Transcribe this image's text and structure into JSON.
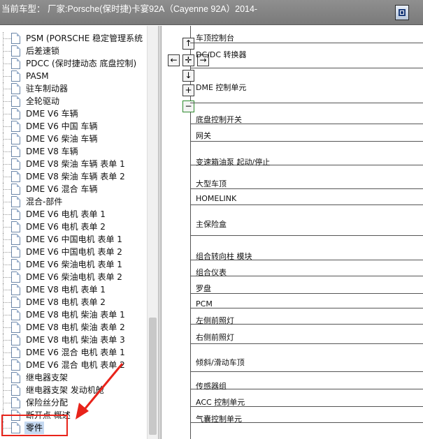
{
  "window": {
    "title": "当前车型： 厂家:Porsche(保时捷)卡宴92A（Cayenne 92A）2014-"
  },
  "tree": {
    "items": [
      {
        "label": "PSM (PORSCHE 稳定管理系统"
      },
      {
        "label": "后差速锁"
      },
      {
        "label": "PDCC (保时捷动态 底盘控制)"
      },
      {
        "label": "PASM"
      },
      {
        "label": "驻车制动器"
      },
      {
        "label": "全轮驱动"
      },
      {
        "label": "DME V6 车辆"
      },
      {
        "label": "DME V6 中国 车辆"
      },
      {
        "label": "DME V6 柴油 车辆"
      },
      {
        "label": "DME V8 车辆"
      },
      {
        "label": "DME V8 柴油 车辆 表单 1"
      },
      {
        "label": "DME V8 柴油 车辆 表单 2"
      },
      {
        "label": "DME V6 混合 车辆"
      },
      {
        "label": "混合-部件"
      },
      {
        "label": "DME V6 电机 表单 1"
      },
      {
        "label": "DME V6 电机 表单 2"
      },
      {
        "label": "DME V6 中国电机 表单 1"
      },
      {
        "label": "DME V6 中国电机 表单 2"
      },
      {
        "label": "DME V6 柴油电机 表单 1"
      },
      {
        "label": "DME V6 柴油电机 表单 2"
      },
      {
        "label": "DME V8 电机 表单 1"
      },
      {
        "label": "DME V8 电机 表单 2"
      },
      {
        "label": "DME V8 电机 柴油 表单 1"
      },
      {
        "label": "DME V8 电机 柴油 表单 2"
      },
      {
        "label": "DME V8 电机 柴油 表单 3"
      },
      {
        "label": "DME V6 混合 电机 表单 1"
      },
      {
        "label": "DME V6 混合 电机 表单 2"
      },
      {
        "label": "继电器支架"
      },
      {
        "label": "继电器支架 发动机舱"
      },
      {
        "label": "保险丝分配"
      },
      {
        "label": "断开点 概述"
      },
      {
        "label": "零件",
        "selected": true
      }
    ]
  },
  "diagram": {
    "nav": {
      "up": "↑",
      "left": "←",
      "center": "✛",
      "right": "→",
      "down": "↓",
      "zoom_in": "+",
      "zoom_out": "−"
    },
    "rows": [
      {
        "label": "车顶控制台"
      },
      {
        "label": "DC/DC 转换器"
      },
      {
        "label": "DME 控制单元"
      },
      {
        "label": "底盘控制开关"
      },
      {
        "label": "网关"
      },
      {
        "label": "变速箱油泵 起动/停止"
      },
      {
        "label": "大型车顶"
      },
      {
        "label": "HOMELINK"
      },
      {
        "label": "主保险盒"
      },
      {
        "label": "组合转向柱 模块"
      },
      {
        "label": "组合仪表"
      },
      {
        "label": "罗盘"
      },
      {
        "label": "PCM"
      },
      {
        "label": "左侧前照灯"
      },
      {
        "label": "右侧前照灯"
      },
      {
        "label": "倾斜/滑动车顶"
      },
      {
        "label": "传感器组"
      },
      {
        "label": "ACC 控制单元"
      },
      {
        "label": "气囊控制单元"
      }
    ]
  },
  "colors": {
    "annotation": "#e8231a",
    "titlebar": "#858585",
    "selection": "#c5d9f1"
  }
}
